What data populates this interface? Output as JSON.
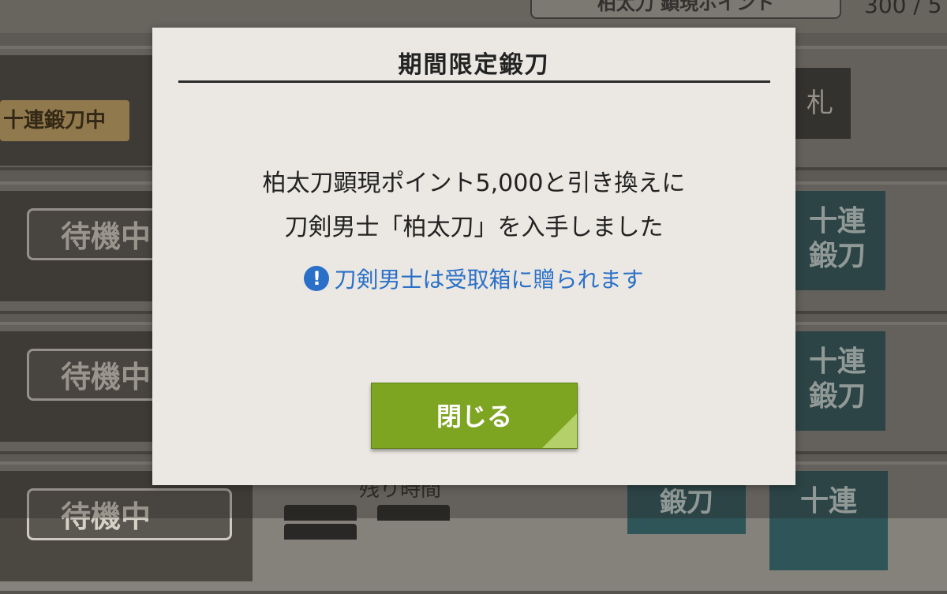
{
  "background": {
    "points_box_label": "柏太刀 顕現ポイント",
    "points_count": "300 / 5",
    "sign_label": "十連鍛刀中",
    "rows": [
      {
        "status": "待機中",
        "button": "十連\n鍛刀"
      },
      {
        "status": "待機中",
        "button": "十連\n鍛刀"
      },
      {
        "status": "待機中",
        "button": "十連",
        "button2": "鍛刀"
      }
    ],
    "top_dark_button": "札",
    "remaining_time_label": "残り時間"
  },
  "dialog": {
    "title": "期間限定鍛刀",
    "message_line1": "柏太刀顕現ポイント5,000と引き換えに",
    "message_line2": "刀剣男士「柏太刀」を入手しました",
    "note_icon": "!",
    "note": "刀剣男士は受取箱に贈られます",
    "close_label": "閉じる"
  },
  "colors": {
    "dialog_bg": "#ebe8e3",
    "note_text": "#2a70c8",
    "close_button": "#7ea521"
  }
}
